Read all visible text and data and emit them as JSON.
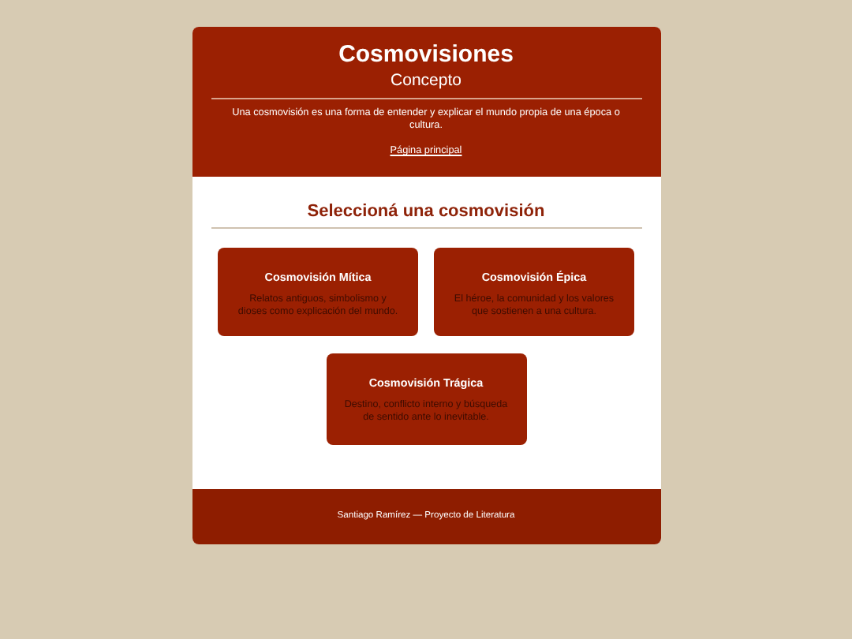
{
  "header": {
    "title": "Cosmovisiones",
    "subtitle": "Concepto",
    "description": "Una cosmovisión es una forma de entender y explicar el mundo propia de una época o cultura.",
    "link": "Página principal"
  },
  "section": {
    "heading": "Seleccioná una cosmovisión"
  },
  "cards": [
    {
      "title": "Cosmovisión Mítica",
      "text": "Relatos antiguos, simbolismo y dioses como explicación del mundo."
    },
    {
      "title": "Cosmovisión Épica",
      "text": "El héroe, la comunidad y los valores que sostienen a una cultura."
    },
    {
      "title": "Cosmovisión Trágica",
      "text": "Destino, conflicto interno y búsqueda de sentido ante lo inevitable."
    }
  ],
  "footer": {
    "text": "Santiago Ramírez — Proyecto de Literatura"
  }
}
